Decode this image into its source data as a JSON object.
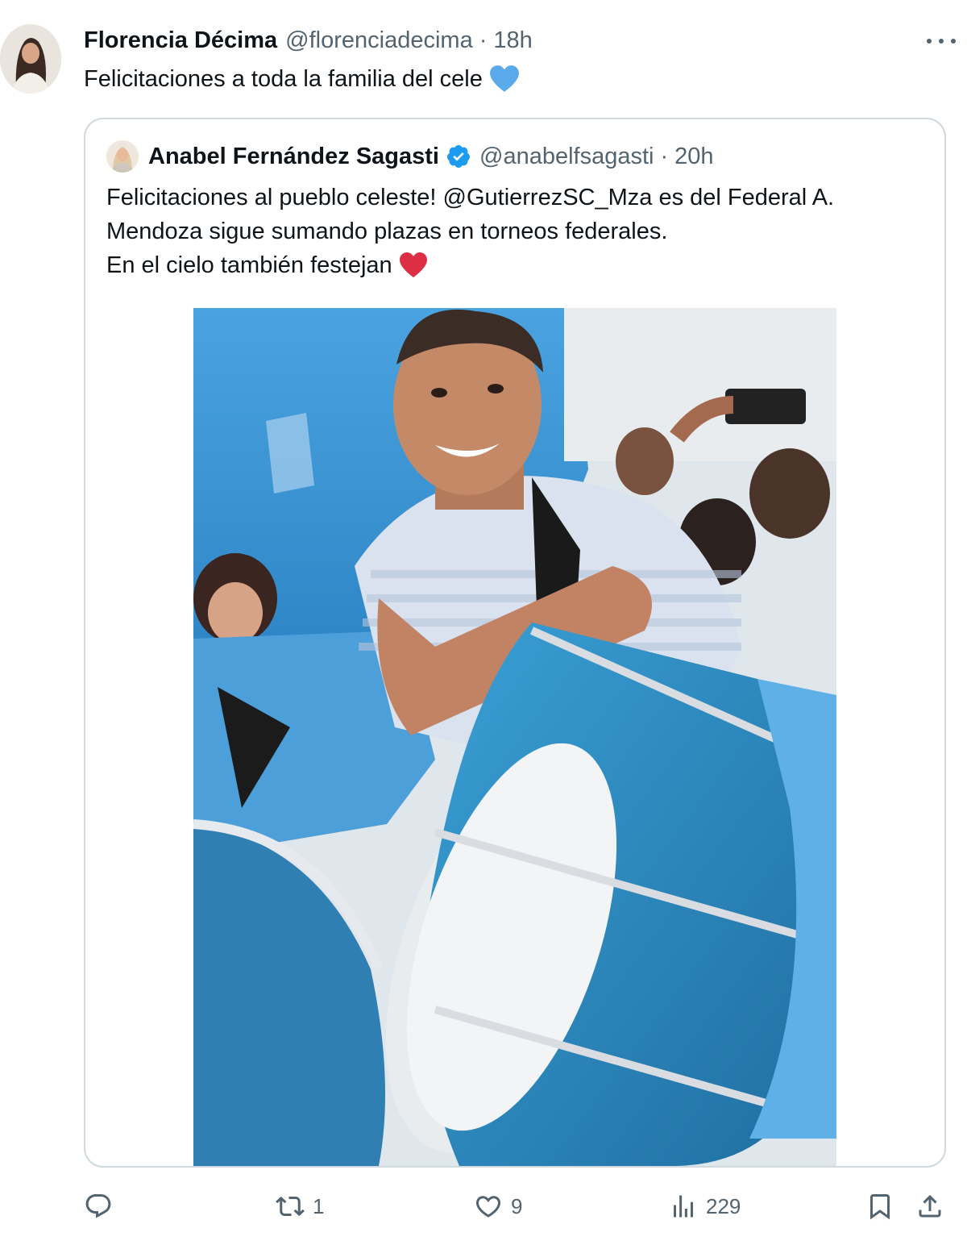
{
  "tweet": {
    "author_name": "Florencia Décima",
    "author_handle": "@florenciadecima",
    "separator": "·",
    "time": "18h",
    "text": "Felicitaciones a toda la familia del cele",
    "emoji": "blue-heart-icon"
  },
  "quoted": {
    "author_name": "Anabel Fernández Sagasti",
    "verified": true,
    "author_handle": "@anabelfsagasti",
    "separator": "·",
    "time": "20h",
    "line1_prefix": "Felicitaciones al pueblo celeste! ",
    "line1_mention": "@GutierrezSC_Mza",
    "line1_suffix": " es del Federal A.",
    "line2": "Mendoza sigue sumando plazas en torneos federales.",
    "line3": "En el cielo también festejan",
    "emoji": "red-heart-icon"
  },
  "actions": {
    "reply_count": "",
    "retweet_count": "1",
    "like_count": "9",
    "views_count": "229"
  },
  "colors": {
    "text": "#0f1419",
    "secondary": "#536471",
    "border": "#cfd9de",
    "verified": "#1d9bf0",
    "heart_blue": "#5aa9ea",
    "heart_red": "#dd2e44"
  }
}
